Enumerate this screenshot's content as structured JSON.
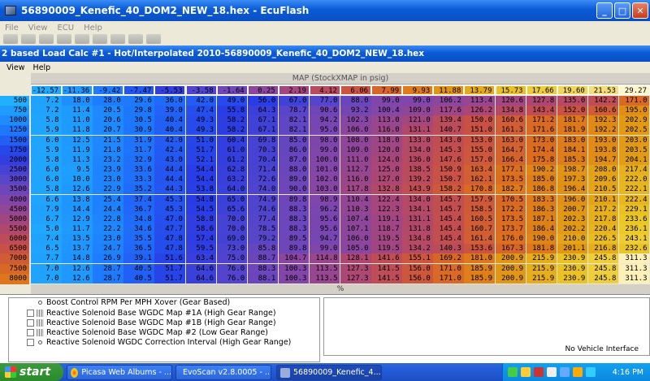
{
  "window": {
    "title": "56890009_Kenefic_40_DOM2_NEW_18.hex - EcuFlash"
  },
  "mainmenu": [
    "File",
    "View",
    "ECU",
    "Help"
  ],
  "child": {
    "title": "2 based Load Calc #1 - Hot/Interpolated 2010-56890009_Kenefic_40_DOM2_NEW_18.hex",
    "menu": [
      "View",
      "Help"
    ]
  },
  "map": {
    "title": "MAP (StockXMAP in psig)",
    "xunit": "%",
    "columns": [
      "-12.57",
      "-11.36",
      "-9.42",
      "-7.47",
      "-5.53",
      "-3.58",
      "-1.64",
      "0.25",
      "2.19",
      "4.12",
      "6.06",
      "7.99",
      "9.93",
      "11.88",
      "13.79",
      "15.73",
      "17.66",
      "19.60",
      "21.53",
      "29.27"
    ],
    "rows": [
      "500",
      "750",
      "1000",
      "1250",
      "1500",
      "1750",
      "2000",
      "2500",
      "3000",
      "3500",
      "4000",
      "4500",
      "5000",
      "5500",
      "6000",
      "6500",
      "7000",
      "7500",
      "8000"
    ],
    "values": [
      [
        "7.2",
        "18.0",
        "28.0",
        "29.6",
        "36.0",
        "42.0",
        "49.0",
        "56.0",
        "67.0",
        "77.0",
        "88.0",
        "99.0",
        "99.0",
        "106.2",
        "113.4",
        "120.6",
        "127.8",
        "135.0",
        "142.2",
        "171.0"
      ],
      [
        "7.2",
        "11.4",
        "20.5",
        "29.8",
        "39.0",
        "47.4",
        "55.8",
        "64.3",
        "78.7",
        "90.6",
        "93.2",
        "100.4",
        "109.0",
        "117.6",
        "126.2",
        "134.8",
        "143.4",
        "152.0",
        "160.6",
        "195.0"
      ],
      [
        "5.8",
        "11.0",
        "20.6",
        "30.5",
        "40.4",
        "49.3",
        "58.2",
        "67.1",
        "82.1",
        "94.2",
        "102.3",
        "113.0",
        "121.0",
        "139.4",
        "150.0",
        "160.6",
        "171.2",
        "181.7",
        "192.3",
        "202.9"
      ],
      [
        "5.9",
        "11.8",
        "20.7",
        "30.9",
        "40.4",
        "49.3",
        "58.2",
        "67.1",
        "82.1",
        "95.0",
        "106.0",
        "116.0",
        "131.1",
        "140.7",
        "151.0",
        "161.3",
        "171.6",
        "181.9",
        "192.2",
        "202.5"
      ],
      [
        "6.0",
        "12.5",
        "21.5",
        "31.9",
        "42.0",
        "51.0",
        "60.4",
        "69.8",
        "85.0",
        "98.0",
        "108.0",
        "118.0",
        "133.0",
        "143.0",
        "153.0",
        "163.0",
        "173.0",
        "183.0",
        "193.0",
        "203.0"
      ],
      [
        "5.9",
        "11.9",
        "21.8",
        "31.7",
        "42.4",
        "51.7",
        "61.0",
        "70.3",
        "86.0",
        "99.0",
        "109.0",
        "120.0",
        "134.0",
        "145.3",
        "155.0",
        "164.7",
        "174.4",
        "184.1",
        "193.8",
        "203.5"
      ],
      [
        "5.8",
        "11.3",
        "23.2",
        "32.9",
        "43.0",
        "52.1",
        "61.2",
        "70.4",
        "87.0",
        "100.0",
        "111.0",
        "124.0",
        "136.0",
        "147.6",
        "157.0",
        "166.4",
        "175.8",
        "185.3",
        "194.7",
        "204.1"
      ],
      [
        "6.0",
        "9.5",
        "23.9",
        "33.6",
        "44.4",
        "54.4",
        "62.8",
        "71.4",
        "88.0",
        "101.0",
        "112.7",
        "125.0",
        "138.5",
        "150.9",
        "163.4",
        "177.1",
        "190.2",
        "198.7",
        "208.0",
        "217.4"
      ],
      [
        "6.0",
        "10.0",
        "23.0",
        "33.3",
        "44.4",
        "54.4",
        "63.2",
        "72.6",
        "89.0",
        "102.0",
        "116.0",
        "127.0",
        "139.2",
        "150.7",
        "162.1",
        "173.5",
        "185.0",
        "197.3",
        "209.6",
        "222.0"
      ],
      [
        "5.8",
        "12.6",
        "22.9",
        "35.2",
        "44.3",
        "53.8",
        "64.0",
        "74.0",
        "90.0",
        "103.0",
        "117.8",
        "132.8",
        "143.9",
        "158.2",
        "170.8",
        "182.7",
        "186.8",
        "196.4",
        "210.5",
        "222.1"
      ],
      [
        "6.6",
        "13.8",
        "25.4",
        "37.4",
        "45.3",
        "54.8",
        "65.0",
        "74.9",
        "89.8",
        "98.9",
        "110.4",
        "122.4",
        "134.0",
        "145.7",
        "157.9",
        "170.5",
        "183.3",
        "196.0",
        "210.1",
        "222.4"
      ],
      [
        "7.9",
        "14.4",
        "24.4",
        "36.7",
        "45.3",
        "54.5",
        "65.6",
        "74.6",
        "88.3",
        "96.2",
        "110.3",
        "122.3",
        "134.1",
        "145.7",
        "158.5",
        "172.2",
        "186.3",
        "200.7",
        "217.2",
        "229.1"
      ],
      [
        "6.7",
        "12.9",
        "22.8",
        "34.8",
        "47.0",
        "58.8",
        "70.0",
        "77.4",
        "88.3",
        "95.6",
        "107.4",
        "119.1",
        "131.1",
        "145.4",
        "160.5",
        "173.5",
        "187.1",
        "202.3",
        "217.8",
        "233.6"
      ],
      [
        "5.0",
        "11.7",
        "22.2",
        "34.6",
        "47.7",
        "58.6",
        "70.0",
        "78.5",
        "88.3",
        "95.6",
        "107.1",
        "118.7",
        "131.8",
        "145.4",
        "160.7",
        "173.7",
        "186.4",
        "202.2",
        "220.4",
        "236.1"
      ],
      [
        "7.4",
        "13.5",
        "23.0",
        "35.5",
        "47.8",
        "57.4",
        "69.0",
        "79.2",
        "89.5",
        "94.7",
        "106.0",
        "119.5",
        "134.8",
        "145.4",
        "161.4",
        "176.0",
        "190.0",
        "210.0",
        "226.5",
        "243.1"
      ],
      [
        "6.5",
        "13.7",
        "24.7",
        "36.5",
        "47.8",
        "59.5",
        "73.0",
        "85.8",
        "89.8",
        "99.0",
        "105.0",
        "119.5",
        "134.2",
        "140.3",
        "153.6",
        "167.3",
        "181.8",
        "201.1",
        "216.8",
        "232.6"
      ],
      [
        "7.7",
        "14.8",
        "26.9",
        "39.1",
        "51.6",
        "63.4",
        "75.0",
        "88.7",
        "104.7",
        "114.8",
        "128.1",
        "141.6",
        "155.1",
        "169.2",
        "181.0",
        "200.9",
        "215.9",
        "230.9",
        "245.8",
        "311.3"
      ],
      [
        "7.0",
        "12.6",
        "28.7",
        "40.5",
        "51.7",
        "64.6",
        "76.0",
        "88.3",
        "100.3",
        "113.5",
        "127.3",
        "141.5",
        "156.0",
        "171.0",
        "185.9",
        "200.9",
        "215.9",
        "230.9",
        "245.8",
        "311.3"
      ],
      [
        "7.0",
        "12.6",
        "28.7",
        "40.5",
        "51.7",
        "64.6",
        "76.0",
        "88.1",
        "100.3",
        "113.5",
        "127.3",
        "141.5",
        "156.0",
        "171.0",
        "185.9",
        "200.9",
        "215.9",
        "230.9",
        "245.8",
        "311.3"
      ]
    ]
  },
  "tree": {
    "items": [
      "Boost Control RPM Per MPH Xover (Gear Based)",
      "Reactive Solenoid Base WGDC Map #1A (High Gear Range)",
      "Reactive Solenoid Base WGDC Map #1B (High Gear Range)",
      "Reactive Solenoid Base WGDC Map #2 (Low Gear Range)",
      "Reactive Solenoid WGDC Correction Interval (High Gear Range)"
    ]
  },
  "status": {
    "interface": "No Vehicle Interface"
  },
  "taskbar": {
    "start": "start",
    "tasks": [
      "Picasa Web Albums - ...",
      "EvoScan v2.8.0005 - ...",
      "56890009_Kenefic_4..."
    ],
    "clock": "4:16 PM"
  },
  "colors": {
    "titlebar": "#0a5bd6",
    "taskbar": "#245edb",
    "start": "#2b8a2b"
  }
}
